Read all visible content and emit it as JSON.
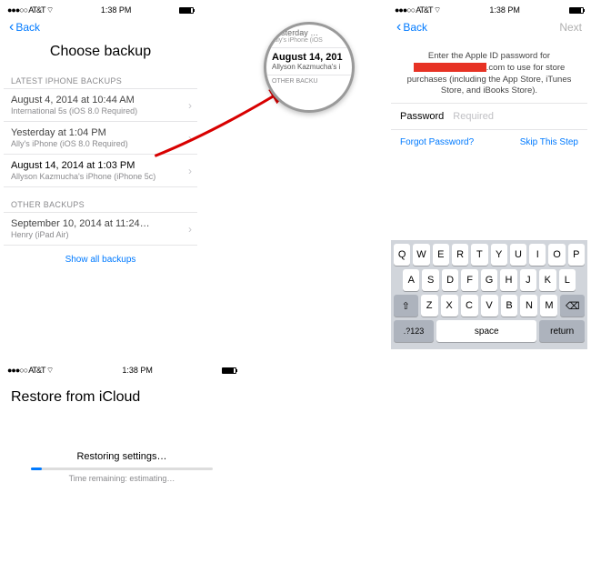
{
  "status": {
    "carrier": "AT&T",
    "time": "1:38 PM",
    "signal": "●●●○○",
    "wifi": "⌔"
  },
  "screenA": {
    "back": "Back",
    "title": "Choose backup",
    "section_latest": "LATEST IPHONE BACKUPS",
    "section_other": "OTHER BACKUPS",
    "show_all": "Show all backups",
    "rows": [
      {
        "primary": "August 4, 2014 at 10:44 AM",
        "secondary": "International 5s (iOS 8.0 Required)"
      },
      {
        "primary": "Yesterday at 1:04 PM",
        "secondary": "Ally's iPhone (iOS 8.0 Required)"
      },
      {
        "primary": "August 14, 2014 at 1:03 PM",
        "secondary": "Allyson Kazmucha's iPhone (iPhone 5c)"
      },
      {
        "primary": "September 10, 2014 at 11:24…",
        "secondary": "Henry (iPad Air)"
      }
    ]
  },
  "magnifier": {
    "top": {
      "primary": "Yesterday …",
      "secondary": "Ally's iPhone (iOS"
    },
    "strong": {
      "primary": "August 14, 201",
      "secondary": "Allyson Kazmucha's i"
    },
    "header": "OTHER BACKU"
  },
  "screenB": {
    "title": "Restore from iCloud",
    "status": "Restoring settings…",
    "eta": "Time remaining: estimating…"
  },
  "screenC": {
    "back": "Back",
    "next": "Next",
    "msg_pre": "Enter the Apple ID password for",
    "msg_post": ".com to use for store purchases (including the App Store, iTunes Store, and iBooks Store).",
    "field_label": "Password",
    "field_placeholder": "Required",
    "forgot": "Forgot Password?",
    "skip": "Skip This Step"
  },
  "keyboard": {
    "row1": [
      "Q",
      "W",
      "E",
      "R",
      "T",
      "Y",
      "U",
      "I",
      "O",
      "P"
    ],
    "row2": [
      "A",
      "S",
      "D",
      "F",
      "G",
      "H",
      "J",
      "K",
      "L"
    ],
    "row3": [
      "Z",
      "X",
      "C",
      "V",
      "B",
      "N",
      "M"
    ],
    "shift": "⇧",
    "backspace": "⌫",
    "mode": ".?123",
    "space": "space",
    "return": "return"
  }
}
